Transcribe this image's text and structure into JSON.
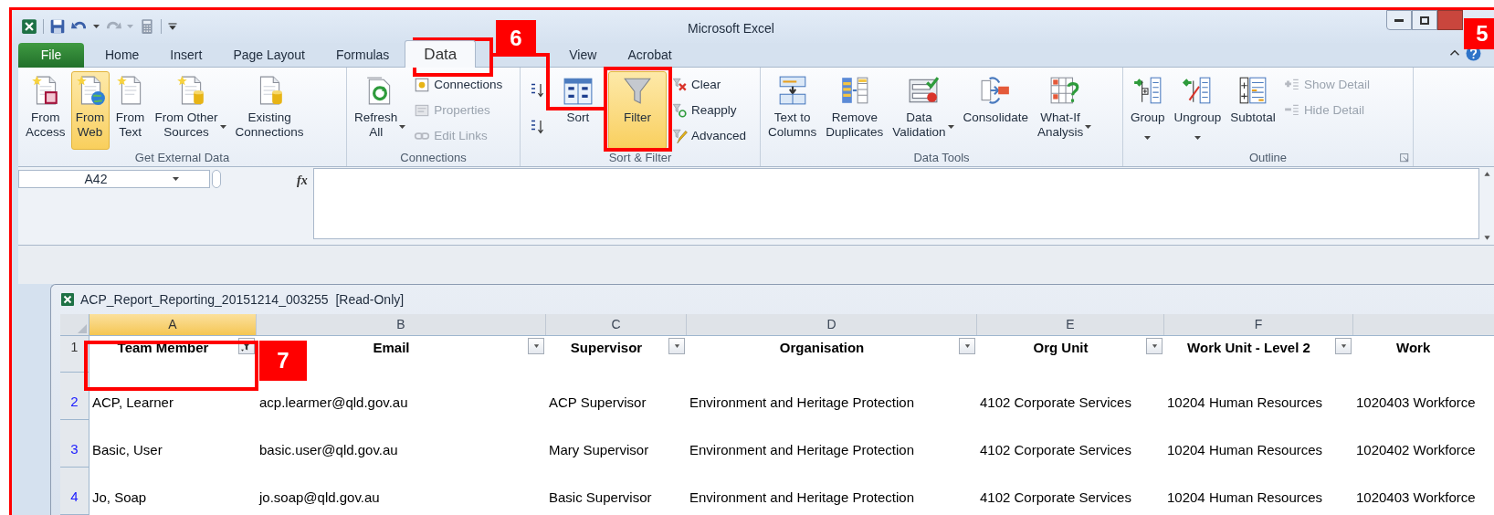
{
  "window": {
    "title": "Microsoft Excel"
  },
  "tabs": [
    {
      "label": "File",
      "kind": "file",
      "selected": false
    },
    {
      "label": "Home",
      "kind": "tab",
      "selected": false
    },
    {
      "label": "Insert",
      "kind": "tab",
      "selected": false
    },
    {
      "label": "Page Layout",
      "kind": "tab",
      "selected": false
    },
    {
      "label": "Formulas",
      "kind": "tab",
      "selected": false
    },
    {
      "label": "Data",
      "kind": "tab",
      "selected": true
    },
    {
      "label": "View",
      "kind": "tab",
      "selected": false
    },
    {
      "label": "Acrobat",
      "kind": "tab",
      "selected": false
    }
  ],
  "ribbon_groups": [
    {
      "label": "Get External Data",
      "kind": "external",
      "launcher": false,
      "items": [
        {
          "kind": "large",
          "label": "From\nAccess",
          "selected": false,
          "dropdown": false
        },
        {
          "kind": "large",
          "label": "From\nWeb",
          "selected": true,
          "dropdown": false
        },
        {
          "kind": "large",
          "label": "From\nText",
          "selected": false,
          "dropdown": false
        },
        {
          "kind": "large",
          "label": "From Other\nSources",
          "selected": false,
          "dropdown": true
        },
        {
          "kind": "large",
          "label": "Existing\nConnections",
          "selected": false,
          "dropdown": false
        }
      ]
    },
    {
      "label": "Connections",
      "kind": "connections",
      "launcher": false,
      "items": [
        {
          "kind": "large",
          "label": "Refresh\nAll",
          "selected": false,
          "dropdown": true
        },
        {
          "kind": "stack",
          "buttons": [
            {
              "label": "Connections",
              "disabled": false
            },
            {
              "label": "Properties",
              "disabled": true
            },
            {
              "label": "Edit Links",
              "disabled": true
            }
          ]
        }
      ]
    },
    {
      "label": "Sort & Filter",
      "kind": "sort",
      "launcher": false,
      "items": [
        {
          "kind": "large",
          "label": "Sort",
          "selected": false,
          "dropdown": false
        },
        {
          "kind": "large",
          "label": "Filter",
          "selected": true,
          "dropdown": false
        },
        {
          "kind": "stack",
          "buttons": [
            {
              "label": "Clear",
              "disabled": false
            },
            {
              "label": "Reapply",
              "disabled": false
            },
            {
              "label": "Advanced",
              "disabled": false
            }
          ]
        }
      ]
    },
    {
      "label": "Data Tools",
      "kind": "tools",
      "launcher": false,
      "items": [
        {
          "kind": "large",
          "label": "Text to\nColumns",
          "selected": false,
          "dropdown": false
        },
        {
          "kind": "large",
          "label": "Remove\nDuplicates",
          "selected": false,
          "dropdown": false
        },
        {
          "kind": "large",
          "label": "Data\nValidation",
          "selected": false,
          "dropdown": true
        },
        {
          "kind": "large",
          "label": "Consolidate",
          "selected": false,
          "dropdown": false
        },
        {
          "kind": "large",
          "label": "What-If\nAnalysis",
          "selected": false,
          "dropdown": true
        }
      ]
    },
    {
      "label": "Outline",
      "kind": "outline",
      "launcher": true,
      "items": [
        {
          "kind": "large",
          "label": "Group",
          "selected": false,
          "dropdown": true
        },
        {
          "kind": "large",
          "label": "Ungroup",
          "selected": false,
          "dropdown": true
        },
        {
          "kind": "large",
          "label": "Subtotal",
          "selected": false,
          "dropdown": false
        },
        {
          "kind": "stack",
          "buttons": [
            {
              "label": "Show Detail",
              "disabled": true
            },
            {
              "label": "Hide Detail",
              "disabled": true
            }
          ]
        }
      ]
    }
  ],
  "formula_bar": {
    "name_box": "A42",
    "fx": "fx"
  },
  "workbook": {
    "title": "ACP_Report_Reporting_20151214_003255  [Read-Only]",
    "columns": [
      {
        "letter": "A",
        "selected": true
      },
      {
        "letter": "B",
        "selected": false
      },
      {
        "letter": "C",
        "selected": false
      },
      {
        "letter": "D",
        "selected": false
      },
      {
        "letter": "E",
        "selected": false
      },
      {
        "letter": "F",
        "selected": false
      }
    ],
    "header_row": {
      "number": "1",
      "cells": [
        {
          "text": "Team Member",
          "filter_applied": true
        },
        {
          "text": "Email",
          "filter_applied": false
        },
        {
          "text": "Supervisor",
          "filter_applied": false
        },
        {
          "text": "Organisation",
          "filter_applied": false
        },
        {
          "text": "Org Unit",
          "filter_applied": false
        },
        {
          "text": "Work Unit - Level 2",
          "filter_applied": false
        },
        {
          "text": "Work"
        }
      ]
    },
    "rows": [
      {
        "number": "2",
        "filtered": true,
        "cells": [
          "ACP, Learner",
          "acp.learmer@qld.gov.au",
          "ACP Supervisor",
          "Environment and Heritage Protection",
          "4102 Corporate Services",
          "10204 Human Resources",
          "1020403 Workforce"
        ]
      },
      {
        "number": "3",
        "filtered": true,
        "cells": [
          "Basic, User",
          "basic.user@qld.gov.au",
          "Mary Supervisor",
          "Environment and Heritage Protection",
          "4102 Corporate Services",
          "10204 Human Resources",
          "1020402 Workforce"
        ]
      },
      {
        "number": "4",
        "filtered": true,
        "cells": [
          "Jo, Soap",
          "jo.soap@qld.gov.au",
          "Basic Supervisor",
          "Environment and Heritage Protection",
          "4102 Corporate Services",
          "10204 Human Resources",
          "1020403 Workforce"
        ]
      }
    ]
  },
  "callouts": [
    {
      "number": "6"
    },
    {
      "number": "5"
    },
    {
      "number": "7"
    }
  ]
}
